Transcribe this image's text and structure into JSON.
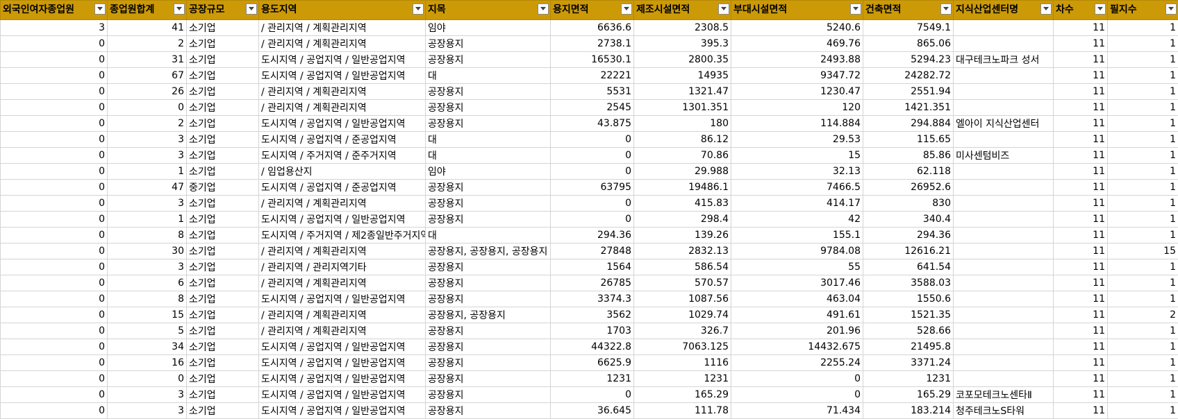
{
  "colors": {
    "header_bg": "#cc9a06",
    "grid_line": "#d4d4d4"
  },
  "icons": {
    "filter": "filter-dropdown-icon"
  },
  "columns": [
    {
      "label": "외국인여자종업원",
      "align": "num"
    },
    {
      "label": "종업원합계",
      "align": "num"
    },
    {
      "label": "공장규모",
      "align": "txt"
    },
    {
      "label": "용도지역",
      "align": "txt"
    },
    {
      "label": "지목",
      "align": "txt"
    },
    {
      "label": "용지면적",
      "align": "num"
    },
    {
      "label": "제조시설면적",
      "align": "num"
    },
    {
      "label": "부대시설면적",
      "align": "num"
    },
    {
      "label": "건축면적",
      "align": "num"
    },
    {
      "label": "지식산업센터명",
      "align": "txt"
    },
    {
      "label": "차수",
      "align": "num"
    },
    {
      "label": "필지수",
      "align": "num"
    }
  ],
  "rows": [
    [
      "3",
      "41",
      "소기업",
      "/ 관리지역 / 계획관리지역",
      "임야",
      "6636.6",
      "2308.5",
      "5240.6",
      "7549.1",
      "",
      "11",
      "1"
    ],
    [
      "0",
      "2",
      "소기업",
      "/ 관리지역 / 계획관리지역",
      "공장용지",
      "2738.1",
      "395.3",
      "469.76",
      "865.06",
      "",
      "11",
      "1"
    ],
    [
      "0",
      "31",
      "소기업",
      "도시지역 / 공업지역 / 일반공업지역",
      "공장용지",
      "16530.1",
      "2800.35",
      "2493.88",
      "5294.23",
      "대구테크노파크 성서",
      "11",
      "1"
    ],
    [
      "0",
      "67",
      "소기업",
      "도시지역 / 공업지역 / 일반공업지역",
      "대",
      "22221",
      "14935",
      "9347.72",
      "24282.72",
      "",
      "11",
      "1"
    ],
    [
      "0",
      "26",
      "소기업",
      "/ 관리지역 / 계획관리지역",
      "공장용지",
      "5531",
      "1321.47",
      "1230.47",
      "2551.94",
      "",
      "11",
      "1"
    ],
    [
      "0",
      "0",
      "소기업",
      "/ 관리지역 / 계획관리지역",
      "공장용지",
      "2545",
      "1301.351",
      "120",
      "1421.351",
      "",
      "11",
      "1"
    ],
    [
      "0",
      "2",
      "소기업",
      "도시지역 / 공업지역 / 일반공업지역",
      "공장용지",
      "43.875",
      "180",
      "114.884",
      "294.884",
      "엘아이 지식산업센터",
      "11",
      "1"
    ],
    [
      "0",
      "3",
      "소기업",
      "도시지역 / 공업지역 / 준공업지역",
      "대",
      "0",
      "86.12",
      "29.53",
      "115.65",
      "",
      "11",
      "1"
    ],
    [
      "0",
      "3",
      "소기업",
      "도시지역 / 주거지역 / 준주거지역",
      "대",
      "0",
      "70.86",
      "15",
      "85.86",
      "미사센텀비즈",
      "11",
      "1"
    ],
    [
      "0",
      "1",
      "소기업",
      "/ 임업용산지",
      "임야",
      "0",
      "29.988",
      "32.13",
      "62.118",
      "",
      "11",
      "1"
    ],
    [
      "0",
      "47",
      "중기업",
      "도시지역 / 공업지역 / 준공업지역",
      "공장용지",
      "63795",
      "19486.1",
      "7466.5",
      "26952.6",
      "",
      "11",
      "1"
    ],
    [
      "0",
      "3",
      "소기업",
      "/ 관리지역 / 계획관리지역",
      "공장용지",
      "0",
      "415.83",
      "414.17",
      "830",
      "",
      "11",
      "1"
    ],
    [
      "0",
      "1",
      "소기업",
      "도시지역 / 공업지역 / 일반공업지역",
      "공장용지",
      "0",
      "298.4",
      "42",
      "340.4",
      "",
      "11",
      "1"
    ],
    [
      "0",
      "8",
      "소기업",
      "도시지역 / 주거지역 / 제2종일반주거지역",
      "대",
      "294.36",
      "139.26",
      "155.1",
      "294.36",
      "",
      "11",
      "1"
    ],
    [
      "0",
      "30",
      "소기업",
      "/ 관리지역 / 계획관리지역",
      "공장용지, 공장용지, 공장용지",
      "27848",
      "2832.13",
      "9784.08",
      "12616.21",
      "",
      "11",
      "15"
    ],
    [
      "0",
      "3",
      "소기업",
      "/ 관리지역 / 관리지역기타",
      "공장용지",
      "1564",
      "586.54",
      "55",
      "641.54",
      "",
      "11",
      "1"
    ],
    [
      "0",
      "6",
      "소기업",
      "/ 관리지역 / 계획관리지역",
      "공장용지",
      "26785",
      "570.57",
      "3017.46",
      "3588.03",
      "",
      "11",
      "1"
    ],
    [
      "0",
      "8",
      "소기업",
      "도시지역 / 공업지역 / 일반공업지역",
      "공장용지",
      "3374.3",
      "1087.56",
      "463.04",
      "1550.6",
      "",
      "11",
      "1"
    ],
    [
      "0",
      "15",
      "소기업",
      "/ 관리지역 / 계획관리지역",
      "공장용지, 공장용지",
      "3562",
      "1029.74",
      "491.61",
      "1521.35",
      "",
      "11",
      "2"
    ],
    [
      "0",
      "5",
      "소기업",
      "/ 관리지역 / 계획관리지역",
      "공장용지",
      "1703",
      "326.7",
      "201.96",
      "528.66",
      "",
      "11",
      "1"
    ],
    [
      "0",
      "34",
      "소기업",
      "도시지역 / 공업지역 / 일반공업지역",
      "공장용지",
      "44322.8",
      "7063.125",
      "14432.675",
      "21495.8",
      "",
      "11",
      "1"
    ],
    [
      "0",
      "16",
      "소기업",
      "도시지역 / 공업지역 / 일반공업지역",
      "공장용지",
      "6625.9",
      "1116",
      "2255.24",
      "3371.24",
      "",
      "11",
      "1"
    ],
    [
      "0",
      "0",
      "소기업",
      "도시지역 / 공업지역 / 일반공업지역",
      "공장용지",
      "1231",
      "1231",
      "0",
      "1231",
      "",
      "11",
      "1"
    ],
    [
      "0",
      "3",
      "소기업",
      "도시지역 / 공업지역 / 일반공업지역",
      "공장용지",
      "0",
      "165.29",
      "0",
      "165.29",
      "코포모테크노센타Ⅱ",
      "11",
      "1"
    ],
    [
      "0",
      "3",
      "소기업",
      "도시지역 / 공업지역 / 일반공업지역",
      "공장용지",
      "36.645",
      "111.78",
      "71.434",
      "183.214",
      "청주테크노S타워",
      "11",
      "1"
    ]
  ]
}
